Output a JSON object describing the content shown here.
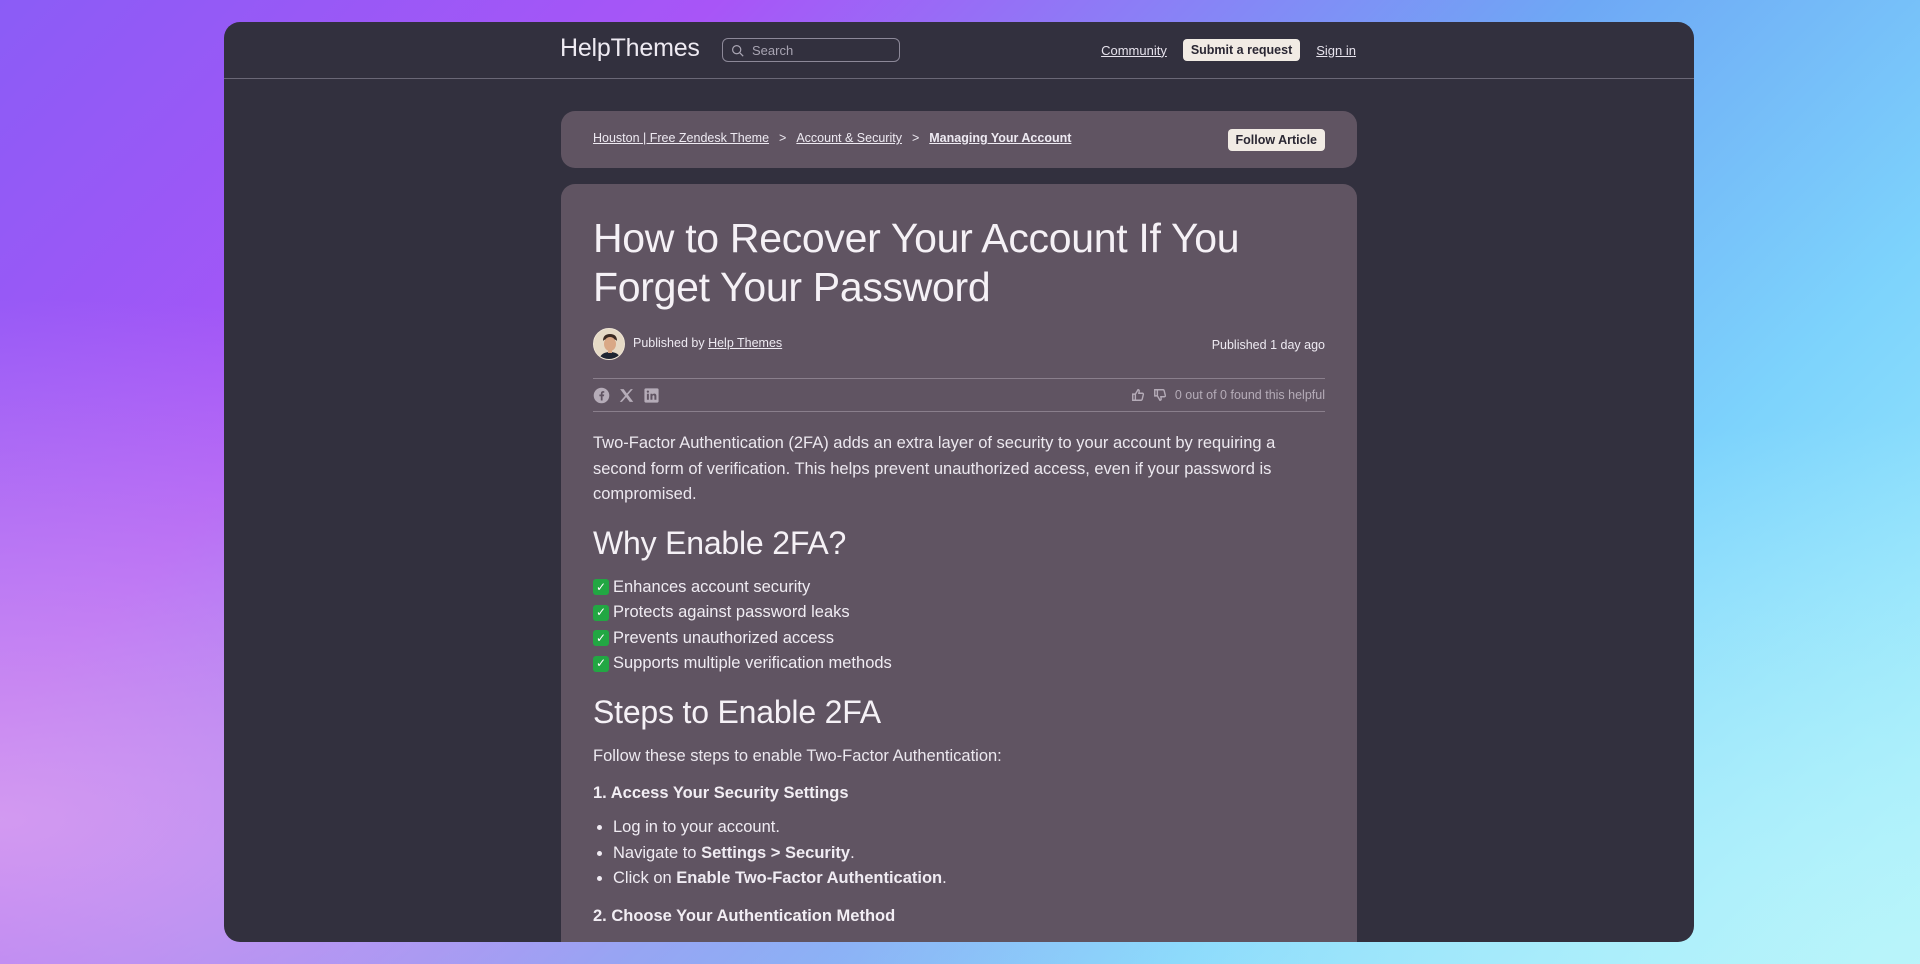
{
  "header": {
    "brand": "HelpThemes",
    "search_placeholder": "Search",
    "community": "Community",
    "submit_request": "Submit a request",
    "sign_in": "Sign in"
  },
  "breadcrumb": {
    "items": [
      "Houston | Free Zendesk Theme",
      "Account & Security",
      "Managing Your Account"
    ],
    "separator": ">",
    "follow": "Follow Article"
  },
  "article": {
    "title": "How to Recover Your Account If You Forget Your Password",
    "published_by_prefix": "Published by",
    "author": "Help Themes",
    "published_label": "Published",
    "published_time": "1 day ago",
    "share_icons": [
      "facebook-icon",
      "x-icon",
      "linkedin-icon"
    ],
    "helpful_text": "0 out of 0 found this helpful",
    "intro": "Two-Factor Authentication (2FA) adds an extra layer of security to your account by requiring a second form of verification. This helps prevent unauthorized access, even if your password is compromised.",
    "why_heading": "Why Enable 2FA?",
    "benefits": [
      "Enhances account security",
      "Protects against password leaks",
      "Prevents unauthorized access",
      "Supports multiple verification methods"
    ],
    "steps_heading": "Steps to Enable 2FA",
    "steps_intro": "Follow these steps to enable Two-Factor Authentication:",
    "step1_heading": "1. Access Your Security Settings",
    "step1_items": {
      "a": "Log in to your account.",
      "b_prefix": "Navigate to ",
      "b_bold": "Settings > Security",
      "b_suffix": ".",
      "c_prefix": "Click on ",
      "c_bold": "Enable Two-Factor Authentication",
      "c_suffix": "."
    },
    "step2_heading": "2. Choose Your Authentication Method"
  },
  "colors": {
    "window_bg": "#32303e",
    "card_bg": "#605462",
    "check_green": "#22a743"
  }
}
